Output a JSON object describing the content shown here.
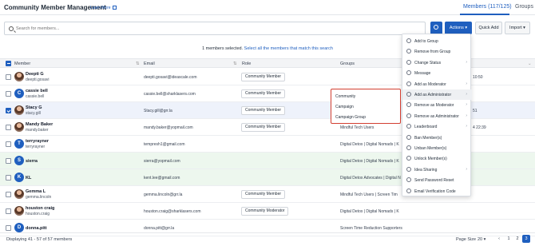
{
  "header": {
    "title": "Community Member Management",
    "learn_more": "Learn More",
    "tab_members": "Members (117/125)",
    "tab_groups": "Groups"
  },
  "toolbar": {
    "search_placeholder": "Search for members...",
    "actions_label": "Actions ▾",
    "quick_add_label": "Quick Add",
    "import_label": "Import ▾"
  },
  "selection": {
    "text": "1 members selected.",
    "link": "Select all the members that match this search"
  },
  "table": {
    "columns": {
      "member": "Member",
      "email": "Email",
      "role": "Role",
      "groups": "Groups"
    },
    "rows": [
      {
        "name": "Deepti G",
        "username": "deepti.gosavi",
        "email": "deepti.gosavi@ideascale.com",
        "role": "Community Member",
        "groups": "",
        "tail": "10:50",
        "avatar": "",
        "checked": false,
        "style": ""
      },
      {
        "name": "cassie bell",
        "username": "cassie.bell",
        "email": "cassie.bell@sharklasers.com",
        "role": "Community Member",
        "groups": "",
        "tail": "",
        "avatar": "C",
        "checked": false,
        "style": ""
      },
      {
        "name": "Stacy G",
        "username": "stacy.gill",
        "email": "Stacy.gill@grr.la",
        "role": "Community Member",
        "groups": "",
        "tail": "51",
        "avatar": "",
        "checked": true,
        "style": "selected"
      },
      {
        "name": "Mandy Baker",
        "username": "mandy.baker",
        "email": "mandy.baker@yopmail.com",
        "role": "Community Member",
        "groups": "Mindful Tech Users",
        "tail": "4 22:39",
        "avatar": "",
        "checked": false,
        "style": ""
      },
      {
        "name": "terryrayner",
        "username": "terryrayner",
        "email": "tempresh1@gmail.com",
        "role": "",
        "groups": "Digital Detox | Digital Nomads | K",
        "tail": "",
        "avatar": "T",
        "checked": false,
        "style": ""
      },
      {
        "name": "sierra",
        "username": "",
        "email": "sierra@yopmail.com",
        "role": "",
        "groups": "Digital Detox | Digital Nomads | K",
        "tail": "",
        "avatar": "S",
        "checked": false,
        "style": "green"
      },
      {
        "name": "KL",
        "username": "",
        "email": "kent.lee@gmail.com",
        "role": "",
        "groups": "Digital Detox Advocates | Digital N",
        "tail": "",
        "avatar": "K",
        "checked": false,
        "style": "green"
      },
      {
        "name": "Gemma L",
        "username": "gemma.lincoln",
        "email": "gemma.lincoln@grr.la",
        "role": "Community Member",
        "groups": "Mindful Tech Users | Screen Tim",
        "tail": "",
        "avatar": "",
        "checked": false,
        "style": ""
      },
      {
        "name": "houston craig",
        "username": "houston.craig",
        "email": "houston.craig@sharklasers.com",
        "role": "Community Moderator",
        "groups": "Digital Detox | Digital Nomads | K",
        "tail": "",
        "avatar": "",
        "checked": false,
        "style": ""
      },
      {
        "name": "donna.pitt",
        "username": "",
        "email": "donna.pitt@grr.la",
        "role": "",
        "groups": "Screen Time Reduction Supporters",
        "tail": "",
        "avatar": "D",
        "checked": false,
        "style": ""
      }
    ]
  },
  "actions_menu": {
    "items": [
      {
        "label": "Add to Group",
        "arrow": ""
      },
      {
        "label": "Remove from Group",
        "arrow": ""
      },
      {
        "label": "Change Status",
        "arrow": "›"
      },
      {
        "label": "Message",
        "arrow": ""
      },
      {
        "label": "Add as Moderator",
        "arrow": "›"
      },
      {
        "label": "Add as Administrator",
        "arrow": "›"
      },
      {
        "label": "Remove as Moderator",
        "arrow": "›"
      },
      {
        "label": "Remove as Administrator",
        "arrow": "›"
      },
      {
        "label": "Leaderboard",
        "arrow": "›"
      },
      {
        "label": "Ban Member(s)",
        "arrow": ""
      },
      {
        "label": "Unban Member(s)",
        "arrow": ""
      },
      {
        "label": "Unlock Member(s)",
        "arrow": ""
      },
      {
        "label": "Idea Sharing",
        "arrow": "›"
      },
      {
        "label": "Send Password Reset",
        "arrow": ""
      },
      {
        "label": "Email Verification Code",
        "arrow": ""
      }
    ],
    "highlighted_index": 5
  },
  "submenu": {
    "items": [
      "Community",
      "Campaign",
      "Campaign Group"
    ]
  },
  "footer": {
    "displaying": "Displaying 41 - 57 of 57 members",
    "page_size_label": "Page Size",
    "page_size_value": "20 ▾",
    "prev": "‹",
    "pages": [
      "1",
      "2",
      "3"
    ],
    "current_page": "3"
  },
  "colors": {
    "accent": "#1f5fbf",
    "submenu_border": "#d23f31",
    "selected_row": "#eef2fb",
    "green_row": "#edf7ee"
  }
}
